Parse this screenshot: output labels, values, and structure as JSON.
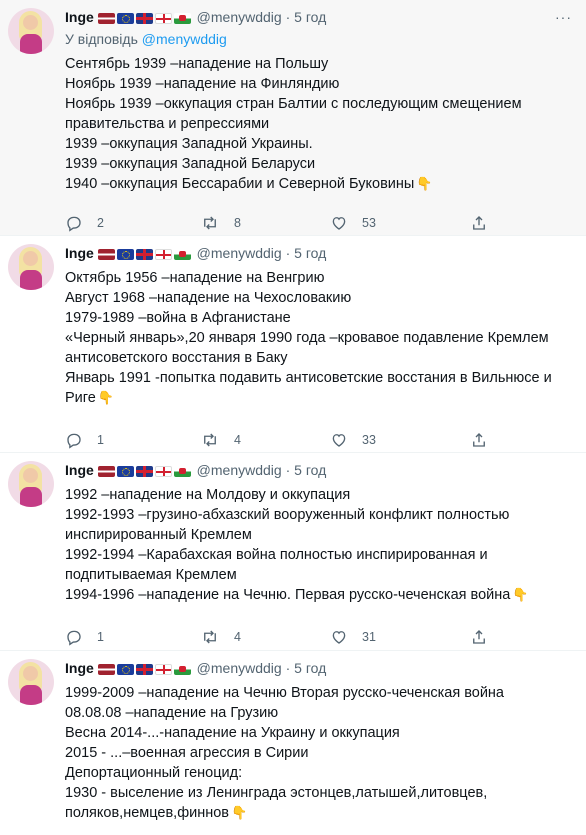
{
  "author": {
    "name": "Inge",
    "handle": "@menywddig",
    "flags": [
      "latvia-flag",
      "eu-flag",
      "uk-flag",
      "england-flag",
      "wales-flag"
    ]
  },
  "tweets": [
    {
      "time": "5 год",
      "reply_to_prefix": "У відповідь",
      "reply_to_handle": "@menywddig",
      "lines": [
        "Сентябрь 1939 –нападение на Польшу",
        "Ноябрь 1939 –нападение на Финляндию",
        "Ноябрь 1939 –оккупация стран Балтии с последующим смещением",
        "правительства и репрессиями",
        "1939 –оккупация Западной Украины.",
        "1939 –оккупация Западной Беларуси",
        "1940 –оккупация Бессарабии и Северной Буковины"
      ],
      "emoji": "👇",
      "replies": "2",
      "retweets": "8",
      "likes": "53"
    },
    {
      "time": "5 год",
      "lines": [
        "Октябрь 1956 –нападение на Венгрию",
        "Август 1968 –нападение на Чехословакию",
        "1979-1989 –война в Афганистане",
        "«Черный январь»,20 января 1990 года –кровавое подавление Кремлем",
        "антисоветского восстания в Баку",
        "Январь 1991 -попытка подавить антисоветские восстания в Вильнюсе и",
        "Риге"
      ],
      "emoji": "👇",
      "replies": "1",
      "retweets": "4",
      "likes": "33"
    },
    {
      "time": "5 год",
      "lines": [
        "1992 –нападение на Молдову и оккупация",
        "1992-1993 –грузино-абхазский вооруженный конфликт полностью",
        "инспирированный Кремлем",
        "1992-1994 –Карабахская война полностью инспирированная и",
        "подпитываемая Кремлем",
        "1994-1996 –нападение на Чечню. Первая русско-чеченская война"
      ],
      "emoji": "👇",
      "replies": "1",
      "retweets": "4",
      "likes": "31"
    },
    {
      "time": "5 год",
      "lines": [
        "1999-2009 –нападение на Чечню Вторая русско-чеченская война",
        "08.08.08 –нападение на Грузию",
        "Весна 2014-...-нападение на Украину и оккупация",
        "2015 - ...–военная агрессия в Сирии",
        "Депортационный геноцид:",
        "1930 - выселение из Ленинграда эстонцев,латышей,литовцев,",
        "поляков,немцев,финнов"
      ],
      "emoji": "👇"
    }
  ],
  "ui": {
    "separator": "·",
    "more": "···"
  }
}
